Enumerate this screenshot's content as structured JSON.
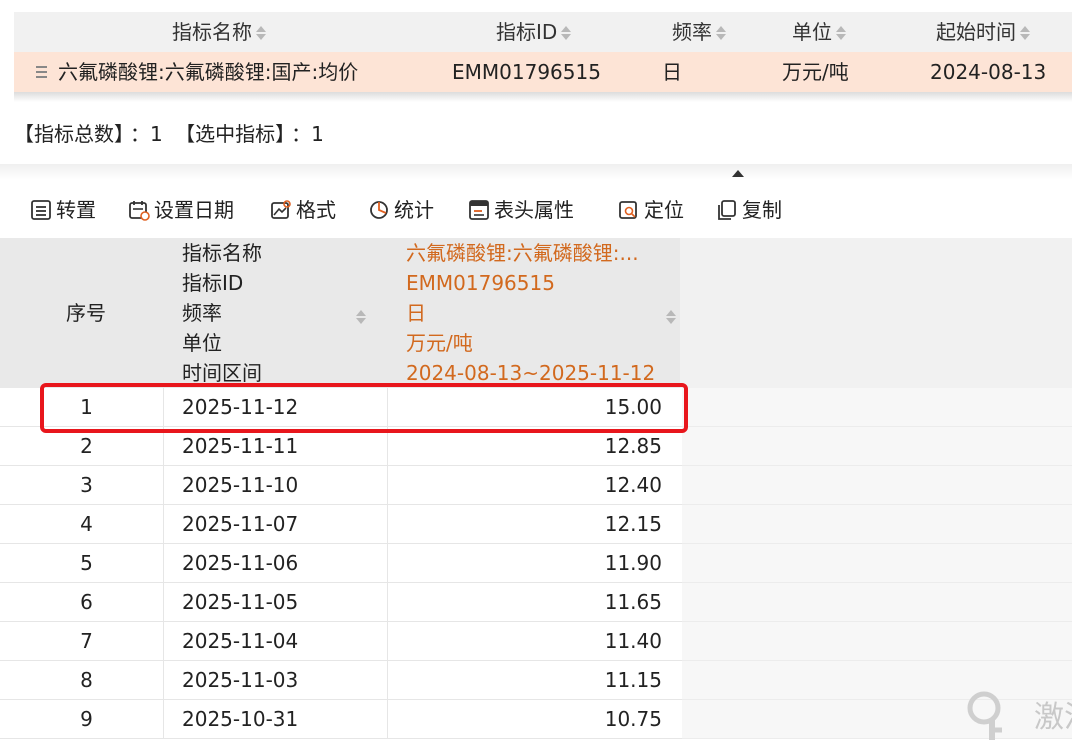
{
  "indicator_list": {
    "columns": {
      "name": "指标名称",
      "id": "指标ID",
      "frequency": "频率",
      "unit": "单位",
      "start": "起始时间"
    },
    "rows": [
      {
        "name": "六氟磷酸锂:六氟磷酸锂:国产:均价",
        "id": "EMM01796515",
        "frequency": "日",
        "unit": "万元/吨",
        "start": "2024-08-13"
      }
    ]
  },
  "summary": {
    "total_label": "【指标总数】",
    "total_value": "：1",
    "selected_label": "【选中指标】",
    "selected_value": "：1"
  },
  "toolbar": {
    "transpose": "转置",
    "set_date": "设置日期",
    "format": "格式",
    "stats": "统计",
    "header_props": "表头属性",
    "locate": "定位",
    "copy": "复制"
  },
  "grid": {
    "seq_header": "序号",
    "header_labels": [
      "指标名称",
      "指标ID",
      "频率",
      "单位",
      "时间区间"
    ],
    "header_values": [
      "六氟磷酸锂:六氟磷酸锂:...",
      "EMM01796515",
      "日",
      "万元/吨",
      "2024-08-13~2025-11-12"
    ],
    "rows": [
      {
        "seq": "1",
        "date": "2025-11-12",
        "value": "15.00"
      },
      {
        "seq": "2",
        "date": "2025-11-11",
        "value": "12.85"
      },
      {
        "seq": "3",
        "date": "2025-11-10",
        "value": "12.40"
      },
      {
        "seq": "4",
        "date": "2025-11-07",
        "value": "12.15"
      },
      {
        "seq": "5",
        "date": "2025-11-06",
        "value": "11.90"
      },
      {
        "seq": "6",
        "date": "2025-11-05",
        "value": "11.65"
      },
      {
        "seq": "7",
        "date": "2025-11-04",
        "value": "11.40"
      },
      {
        "seq": "8",
        "date": "2025-11-03",
        "value": "11.15"
      },
      {
        "seq": "9",
        "date": "2025-10-31",
        "value": "10.75"
      }
    ]
  },
  "colors": {
    "selected_row": "#fde4d6",
    "header_value_text": "#d2691e",
    "highlight_border": "#e8161c"
  },
  "watermark": {
    "text": "激活"
  }
}
